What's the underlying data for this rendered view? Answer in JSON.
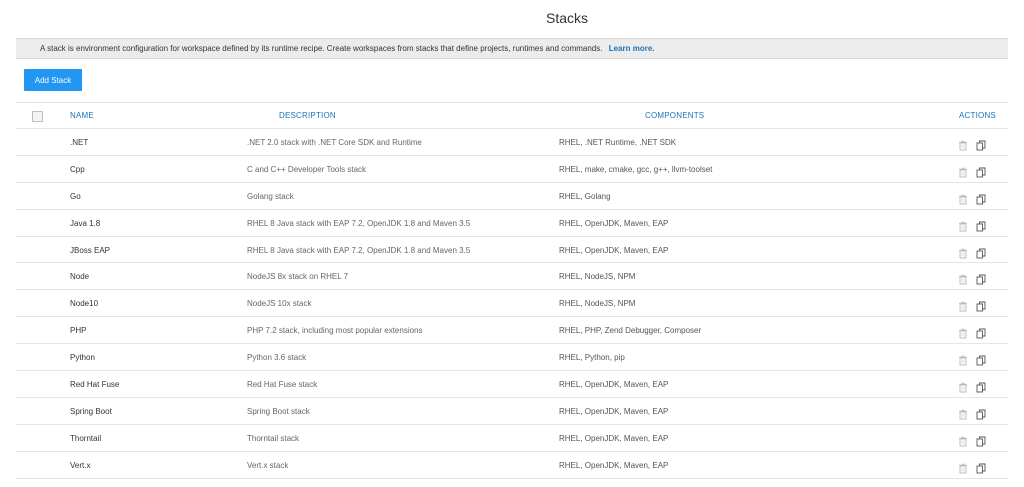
{
  "page": {
    "title": "Stacks"
  },
  "info": {
    "text": "A stack is environment configuration for workspace defined by its runtime recipe. Create workspaces from stacks that define projects, runtimes and commands.",
    "link": "Learn more."
  },
  "toolbar": {
    "add_label": "Add Stack"
  },
  "table": {
    "headers": {
      "name": "NAME",
      "description": "DESCRIPTION",
      "components": "COMPONENTS",
      "actions": "ACTIONS"
    },
    "rows": [
      {
        "name": ".NET",
        "description": ".NET 2.0 stack with .NET Core SDK and Runtime",
        "components": "RHEL, .NET Runtime, .NET SDK"
      },
      {
        "name": "Cpp",
        "description": "C and C++ Developer Tools stack",
        "components": "RHEL, make, cmake, gcc, g++, llvm-toolset"
      },
      {
        "name": "Go",
        "description": "Golang stack",
        "components": "RHEL, Golang"
      },
      {
        "name": "Java 1.8",
        "description": "RHEL 8 Java stack with EAP 7.2, OpenJDK 1.8 and Maven 3.5",
        "components": "RHEL, OpenJDK, Maven, EAP"
      },
      {
        "name": "JBoss EAP",
        "description": "RHEL 8 Java stack with EAP 7.2, OpenJDK 1.8 and Maven 3.5",
        "components": "RHEL, OpenJDK, Maven, EAP"
      },
      {
        "name": "Node",
        "description": "NodeJS 8x stack on RHEL 7",
        "components": "RHEL, NodeJS, NPM"
      },
      {
        "name": "Node10",
        "description": "NodeJS 10x stack",
        "components": "RHEL, NodeJS, NPM"
      },
      {
        "name": "PHP",
        "description": "PHP 7.2 stack, including most popular extensions",
        "components": "RHEL, PHP, Zend Debugger, Composer"
      },
      {
        "name": "Python",
        "description": "Python 3.6 stack",
        "components": "RHEL, Python, pip"
      },
      {
        "name": "Red Hat Fuse",
        "description": "Red Hat Fuse stack",
        "components": "RHEL, OpenJDK, Maven, EAP"
      },
      {
        "name": "Spring Boot",
        "description": "Spring Boot stack",
        "components": "RHEL, OpenJDK, Maven, EAP"
      },
      {
        "name": "Thorntail",
        "description": "Thorntail stack",
        "components": "RHEL, OpenJDK, Maven, EAP"
      },
      {
        "name": "Vert.x",
        "description": "Vert.x stack",
        "components": "RHEL, OpenJDK, Maven, EAP"
      }
    ]
  },
  "icons": {
    "delete": "trash-icon",
    "duplicate": "copy-icon"
  },
  "colors": {
    "accent": "#2196f3",
    "link": "#1a73b8"
  }
}
